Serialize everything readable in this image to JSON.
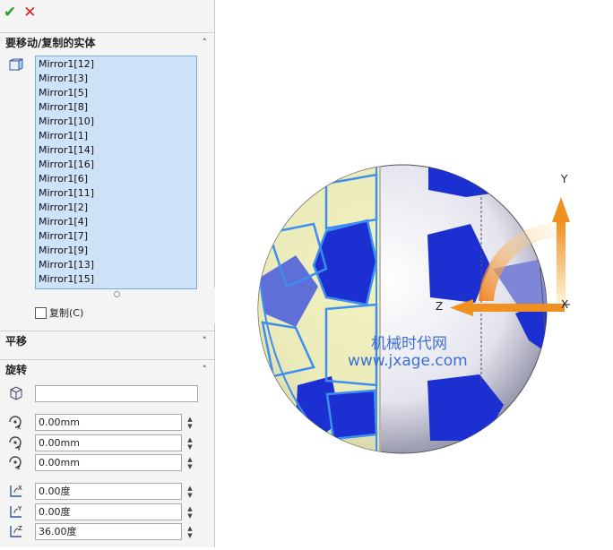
{
  "toolbar": {
    "ok_glyph": "✔",
    "cancel_glyph": "✕"
  },
  "sections": {
    "bodies": {
      "title": "要移动/复制的实体"
    },
    "translate": {
      "title": "平移"
    },
    "rotate": {
      "title": "旋转"
    }
  },
  "bodies_list": [
    "Mirror1[12]",
    "Mirror1[3]",
    "Mirror1[5]",
    "Mirror1[8]",
    "Mirror1[10]",
    "Mirror1[1]",
    "Mirror1[14]",
    "Mirror1[16]",
    "Mirror1[6]",
    "Mirror1[11]",
    "Mirror1[2]",
    "Mirror1[4]",
    "Mirror1[7]",
    "Mirror1[9]",
    "Mirror1[13]",
    "Mirror1[15]"
  ],
  "copy_label": "复制(C)",
  "rotate": {
    "reference": "",
    "x": "0.00mm",
    "y": "0.00mm",
    "z": "0.00mm",
    "angle_x": "0.00度",
    "angle_y": "0.00度",
    "angle_z": "36.00度"
  },
  "triad": {
    "x_label": "X",
    "y_label": "Y",
    "z_label": "Z"
  },
  "watermark": {
    "line1": "机械时代网",
    "line2": "www.jxage.com"
  },
  "colors": {
    "triad_arrow": "#f0a030",
    "selection_blue": "#3d8ef0",
    "panel_blue": "#1c2fd0",
    "selected_face": "#eeeeaa"
  }
}
